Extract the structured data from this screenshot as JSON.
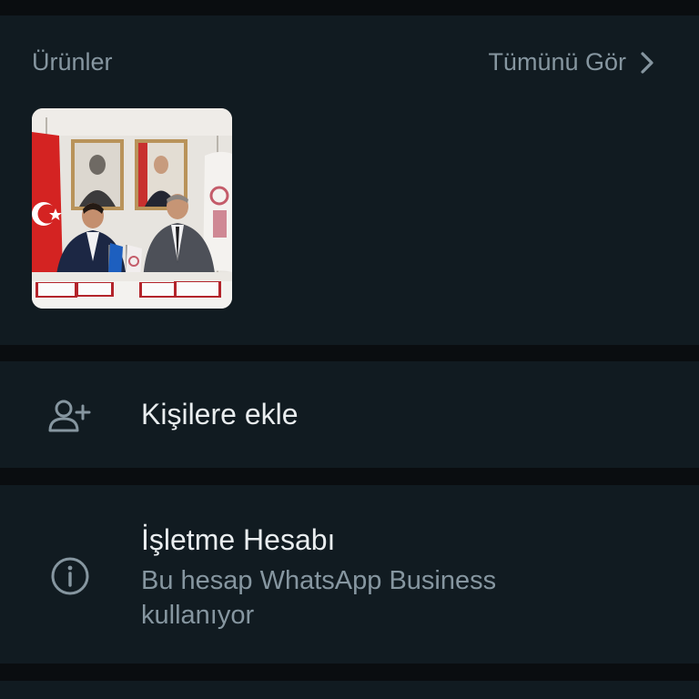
{
  "products": {
    "title": "Ürünler",
    "see_all_label": "Tümünü Gör",
    "see_all_icon": "chevron-right-icon",
    "items": [
      {
        "image": "signing-ceremony-photo"
      }
    ]
  },
  "add_contact": {
    "label": "Kişilere ekle",
    "icon": "person-add-icon"
  },
  "business": {
    "title": "İşletme Hesabı",
    "subtitle": "Bu hesap WhatsApp Business kullanıyor",
    "icon": "info-icon"
  },
  "colors": {
    "background": "#0a0d10",
    "panel": "#111b21",
    "primary_text": "#e9edef",
    "secondary_text": "#8696a0"
  }
}
